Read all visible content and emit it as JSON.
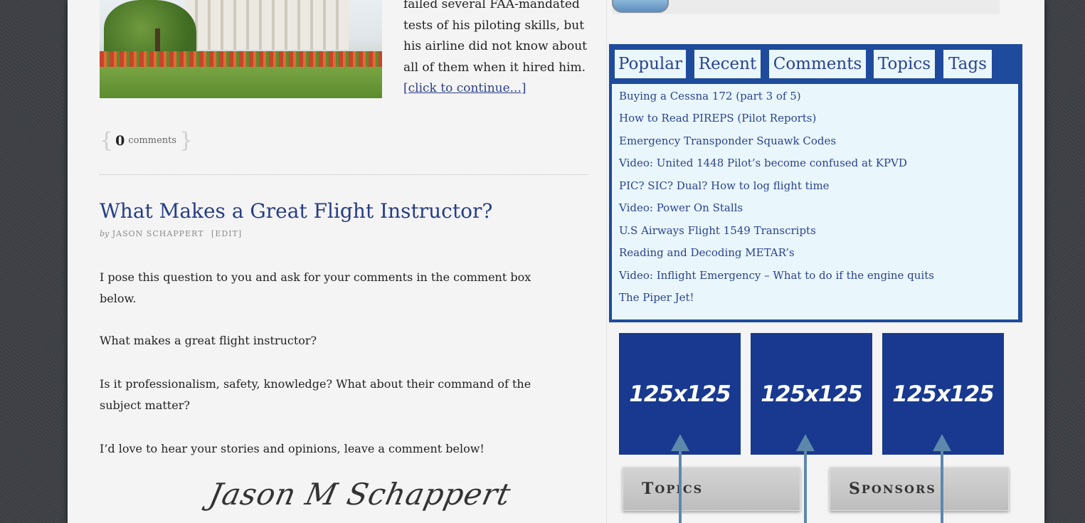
{
  "excerpt": {
    "lines": [
      "failed several FAA-mandated",
      "tests of his piloting skills, but",
      "his airline did not know about",
      "all of them when it hired him."
    ],
    "continue_link": "[click to continue...]"
  },
  "comments": {
    "open": "{",
    "count": "0",
    "label": "comments",
    "close": "}"
  },
  "post": {
    "title": "What Makes a Great Flight Instructor?",
    "by_prefix": "by",
    "author": "JASON SCHAPPERT",
    "edit": "[EDIT]",
    "paragraphs": [
      "I pose this question to you and ask for your comments in the comment box below.",
      "What makes a great flight instructor?",
      "Is it professionalism, safety, knowledge? What about their command of the subject matter?",
      "I’d love to hear your stories and opinions, leave a comment below!"
    ],
    "signature": "Jason M Schappert"
  },
  "sidebar": {
    "tabs": [
      "Popular",
      "Recent",
      "Comments",
      "Topics",
      "Tags"
    ],
    "popular_items": [
      "Buying a Cessna 172 (part 3 of 5)",
      "How to Read PIREPS (Pilot Reports)",
      "Emergency Transponder Squawk Codes",
      "Video: United 1448 Pilot’s become confused at KPVD",
      "PIC? SIC? Dual? How to log flight time",
      "Video: Power On Stalls",
      "U.S Airways Flight 1549 Transcripts",
      "Reading and Decoding METAR’s",
      "Video: Inflight Emergency – What to do if the engine quits",
      "The Piper Jet!"
    ],
    "ads": [
      "125x125",
      "125x125",
      "125x125"
    ],
    "widgets": [
      {
        "first": "T",
        "rest": "OPICS"
      },
      {
        "first": "S",
        "rest": "PONSORS"
      }
    ]
  },
  "colors": {
    "accent": "#1f4b9c",
    "link": "#2b4290",
    "ad": "#18398f",
    "arrow": "#5e88ab"
  }
}
